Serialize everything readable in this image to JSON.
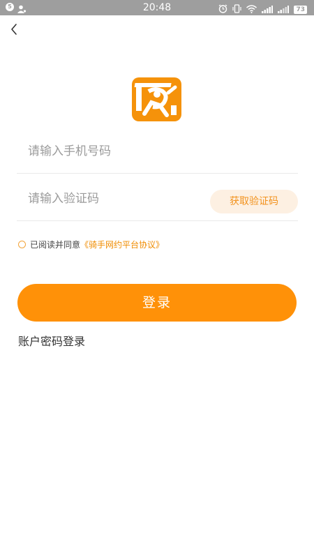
{
  "status_bar": {
    "time": "20:48",
    "left_badge": "5",
    "battery": "73"
  },
  "icons": {
    "back": "back-arrow-icon",
    "logo": "app-logo-icon",
    "alarm": "alarm-icon",
    "vibrate": "vibrate-icon",
    "wifi": "wifi-icon",
    "signal": "signal-icon"
  },
  "form": {
    "phone_placeholder": "请输入手机号码",
    "phone_value": "",
    "code_placeholder": "请输入验证码",
    "code_value": "",
    "get_code_label": "获取验证码"
  },
  "agreement": {
    "prefix": "已阅读并同意",
    "link": "《骑手网约平台协议》"
  },
  "login_label": "登录",
  "password_login_label": "账户密码登录",
  "colors": {
    "accent": "#ff9108",
    "accent_light": "#fdf0e2",
    "status_bar": "#9e9e9e"
  }
}
